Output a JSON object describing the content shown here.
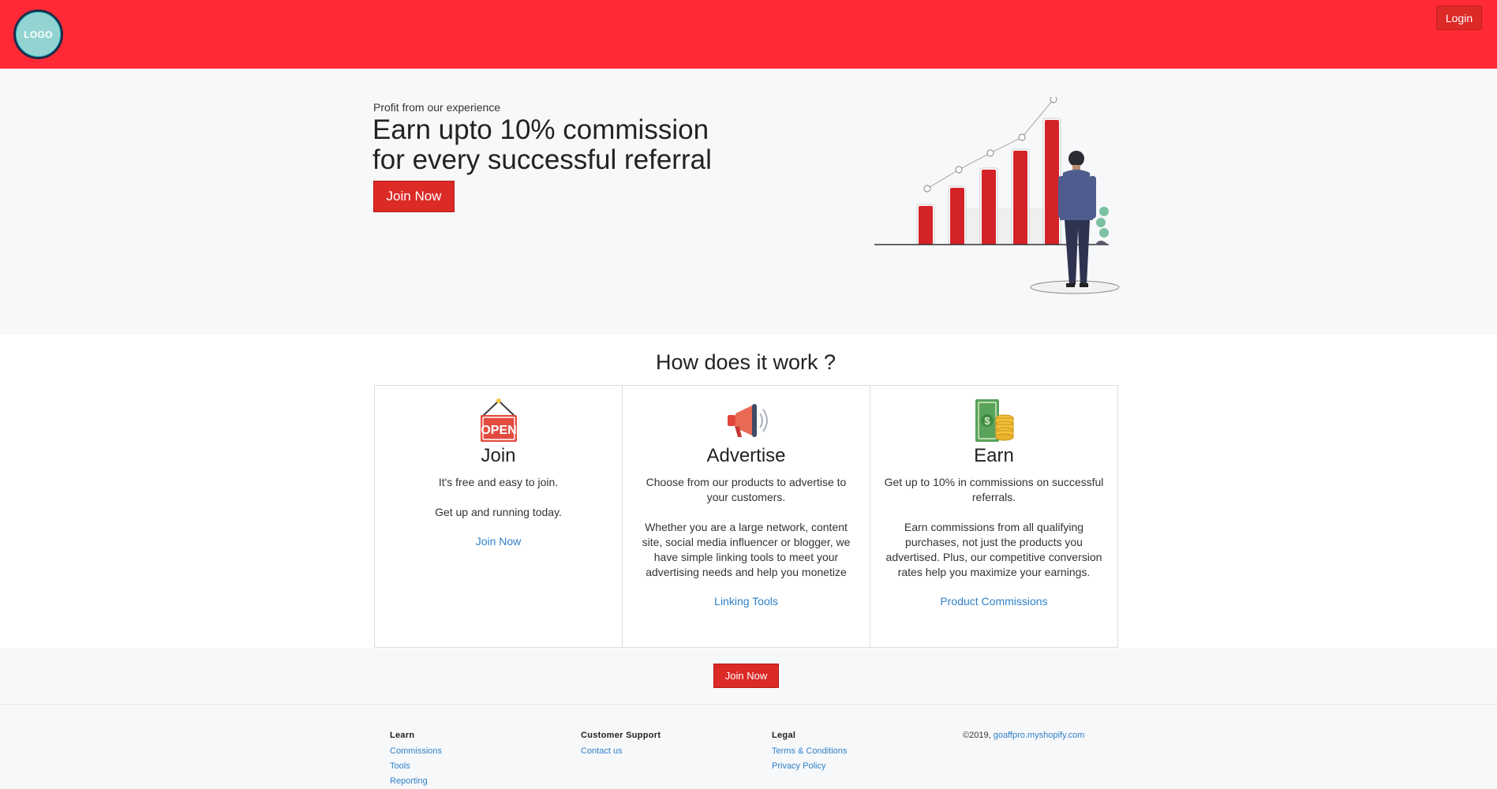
{
  "header": {
    "logo_text": "LOGO",
    "login_label": "Login",
    "accent_color": "#ff2a36"
  },
  "hero": {
    "kicker": "Profit from our experience",
    "title_line1": "Earn upto 10% commission",
    "title_line2": "for every successful referral",
    "cta_label": "Join Now",
    "illustration": "growth-chart-person-icon"
  },
  "how": {
    "title": "How does it work ?",
    "cards": [
      {
        "icon": "open-sign-icon",
        "title": "Join",
        "text": "It's free and easy to join.\n\nGet up and running today.",
        "link": "Join Now"
      },
      {
        "icon": "megaphone-icon",
        "title": "Advertise",
        "text": "Choose from our products to advertise to your customers.\n\nWhether you are a large network, content site, social media influencer or blogger, we have simple linking tools to meet your advertising needs and help you monetize",
        "link": "Linking Tools"
      },
      {
        "icon": "money-coins-icon",
        "title": "Earn",
        "text": "Get up to 10% in commissions on successful referrals.\n\nEarn commissions from all qualifying purchases, not just the products you advertised. Plus, our competitive conversion rates help you maximize your earnings.",
        "link": "Product Commissions"
      }
    ]
  },
  "cta": {
    "label": "Join Now"
  },
  "footer": {
    "learn": {
      "heading": "Learn",
      "links": [
        "Commissions",
        "Tools",
        "Reporting"
      ]
    },
    "support": {
      "heading": "Customer Support",
      "links": [
        "Contact us"
      ]
    },
    "legal": {
      "heading": "Legal",
      "links": [
        "Terms & Conditions",
        "Privacy Policy"
      ]
    },
    "copyright_prefix": "©2019, ",
    "copyright_link": "goaffpro.myshopify.com"
  }
}
